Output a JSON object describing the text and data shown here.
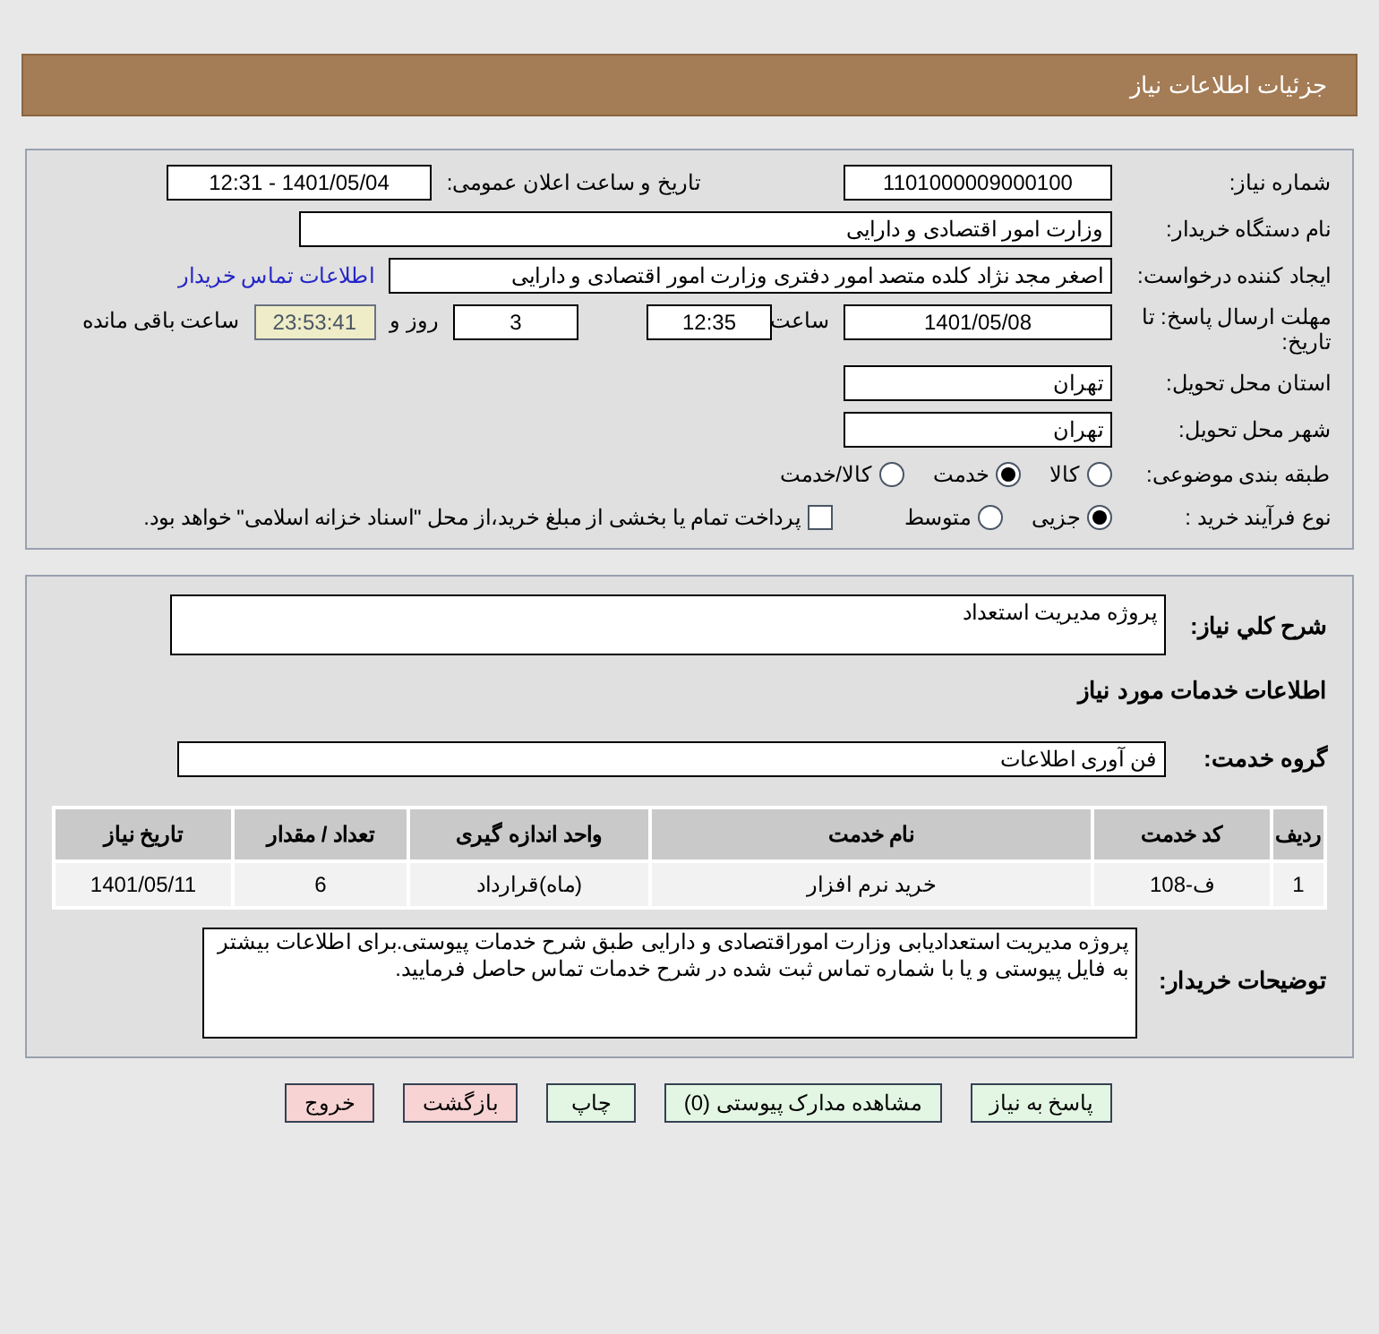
{
  "header": {
    "title": "جزئیات اطلاعات نیاز"
  },
  "need_number": {
    "label": "شماره نیاز:",
    "value": "1101000009000100"
  },
  "announce": {
    "label": "تاریخ و ساعت اعلان عمومی:",
    "value": "1401/05/04 - 12:31"
  },
  "buyer_org": {
    "label": "نام دستگاه خریدار:",
    "value": "وزارت امور اقتصادی و دارایی"
  },
  "creator": {
    "label": "ایجاد کننده درخواست:",
    "value": "اصغر مجد نژاد کلده متصد امور دفتری وزارت امور اقتصادی و دارایی",
    "link": "اطلاعات تماس خریدار"
  },
  "deadline": {
    "label": "مهلت ارسال پاسخ: تا تاریخ:",
    "date": "1401/05/08",
    "time_label": "ساعت",
    "time": "12:35",
    "days": "3",
    "days_label": "روز و",
    "remaining": "23:53:41",
    "remaining_label": "ساعت باقی مانده"
  },
  "province": {
    "label": "استان محل تحویل:",
    "value": "تهران"
  },
  "city": {
    "label": "شهر محل تحویل:",
    "value": "تهران"
  },
  "category": {
    "label": "طبقه بندی موضوعی:",
    "options": [
      {
        "label": "کالا",
        "selected": false
      },
      {
        "label": "خدمت",
        "selected": true
      },
      {
        "label": "کالا/خدمت",
        "selected": false
      }
    ]
  },
  "process": {
    "label": "نوع فرآیند خرید :",
    "options": [
      {
        "label": "جزیی",
        "selected": true
      },
      {
        "label": "متوسط",
        "selected": false
      }
    ],
    "treasury": {
      "label": "پرداخت تمام یا بخشی از مبلغ خرید،از محل \"اسناد خزانه اسلامی\" خواهد بود.",
      "checked": false
    }
  },
  "summary": {
    "label": "شرح کلي نياز:",
    "value": "پروژه مدیریت استعداد"
  },
  "services_heading": "اطلاعات خدمات مورد نیاز",
  "service_group": {
    "label": "گروه خدمت:",
    "value": "فن آوری اطلاعات"
  },
  "table": {
    "columns": [
      "ردیف",
      "کد خدمت",
      "نام خدمت",
      "واحد اندازه گیری",
      "تعداد / مقدار",
      "تاریخ نیاز"
    ],
    "rows": [
      [
        "1",
        "ف-108",
        "خرید نرم افزار",
        "(ماه)قرارداد",
        "6",
        "1401/05/11"
      ]
    ]
  },
  "buyer_notes": {
    "label": "توضیحات خریدار:",
    "value": "پروژه مدیریت استعدادیابی وزارت اموراقتصادی و دارایی طبق شرح خدمات پیوستی.برای اطلاعات بیشتر به فایل پیوستی و یا با شماره تماس ثبت شده در شرح خدمات تماس حاصل فرمایید."
  },
  "buttons": [
    {
      "label": "پاسخ به نیاز",
      "kind": "action"
    },
    {
      "label": "مشاهده مدارک پیوستی (0)",
      "kind": "action"
    },
    {
      "label": "چاپ",
      "kind": "action"
    },
    {
      "label": "بازگشت",
      "kind": "exit"
    },
    {
      "label": "خروج",
      "kind": "exit"
    }
  ]
}
